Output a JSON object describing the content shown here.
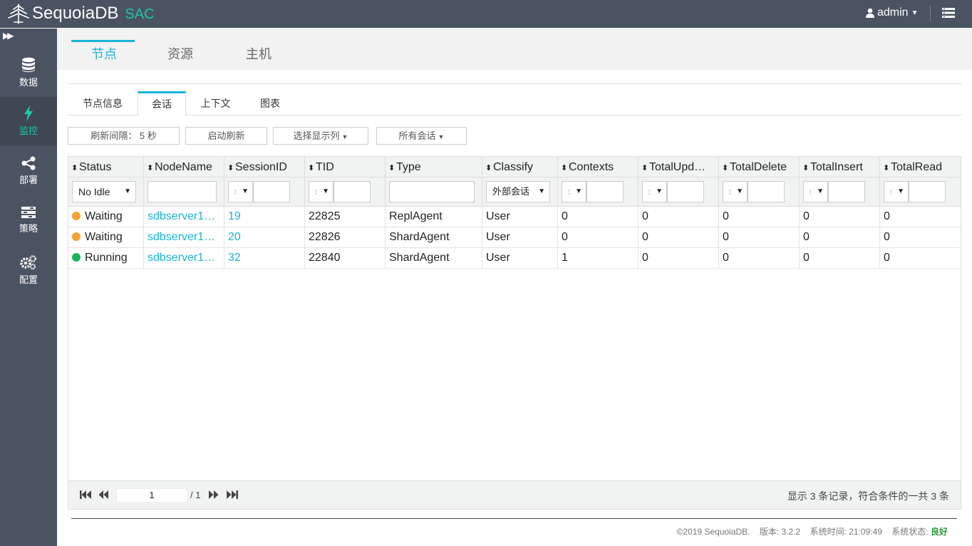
{
  "header": {
    "logo_text": "SequoiaDB",
    "logo_sub": "SAC",
    "user": "admin"
  },
  "sidebar": {
    "items": [
      {
        "label": "数据",
        "icon": "database-icon"
      },
      {
        "label": "监控",
        "icon": "lightning-icon"
      },
      {
        "label": "部署",
        "icon": "share-icon"
      },
      {
        "label": "策略",
        "icon": "strategy-icon"
      },
      {
        "label": "配置",
        "icon": "gears-icon"
      }
    ],
    "active_index": 1
  },
  "main_tabs": [
    "节点",
    "资源",
    "主机"
  ],
  "sub_tabs": [
    "节点信息",
    "会话",
    "上下文",
    "图表"
  ],
  "toolbar": {
    "refresh_interval": "刷新间隔： 5 秒",
    "start_refresh": "启动刷新",
    "select_columns": "选择显示列",
    "all_sessions": "所有会话"
  },
  "grid": {
    "columns": [
      "Status",
      "NodeName",
      "SessionID",
      "TID",
      "Type",
      "Classify",
      "Contexts",
      "TotalUpd…",
      "TotalDelete",
      "TotalInsert",
      "TotalRead"
    ],
    "filters": {
      "status": "No Idle",
      "classify": "外部会话",
      "op": ":"
    },
    "rows": [
      {
        "status": "Waiting",
        "status_color": "#f5a234",
        "node": "sdbserver1…",
        "session": "19",
        "tid": "22825",
        "type": "ReplAgent",
        "classify": "User",
        "contexts": "0",
        "upd": "0",
        "del": "0",
        "ins": "0",
        "read": "0"
      },
      {
        "status": "Waiting",
        "status_color": "#f5a234",
        "node": "sdbserver1…",
        "session": "20",
        "tid": "22826",
        "type": "ShardAgent",
        "classify": "User",
        "contexts": "0",
        "upd": "0",
        "del": "0",
        "ins": "0",
        "read": "0"
      },
      {
        "status": "Running",
        "status_color": "#18b55a",
        "node": "sdbserver1…",
        "session": "32",
        "tid": "22840",
        "type": "ShardAgent",
        "classify": "User",
        "contexts": "1",
        "upd": "0",
        "del": "0",
        "ins": "0",
        "read": "0"
      }
    ]
  },
  "pager": {
    "page": "1",
    "total": "/ 1",
    "info": "显示 3 条记录，符合条件的一共 3 条"
  },
  "footer": {
    "copyright": "©2019 SequoiaDB.",
    "version": "版本: 3.2.2",
    "time": "系统时间: 21:09:49",
    "status_label": "系统状态:",
    "status_value": "良好"
  }
}
